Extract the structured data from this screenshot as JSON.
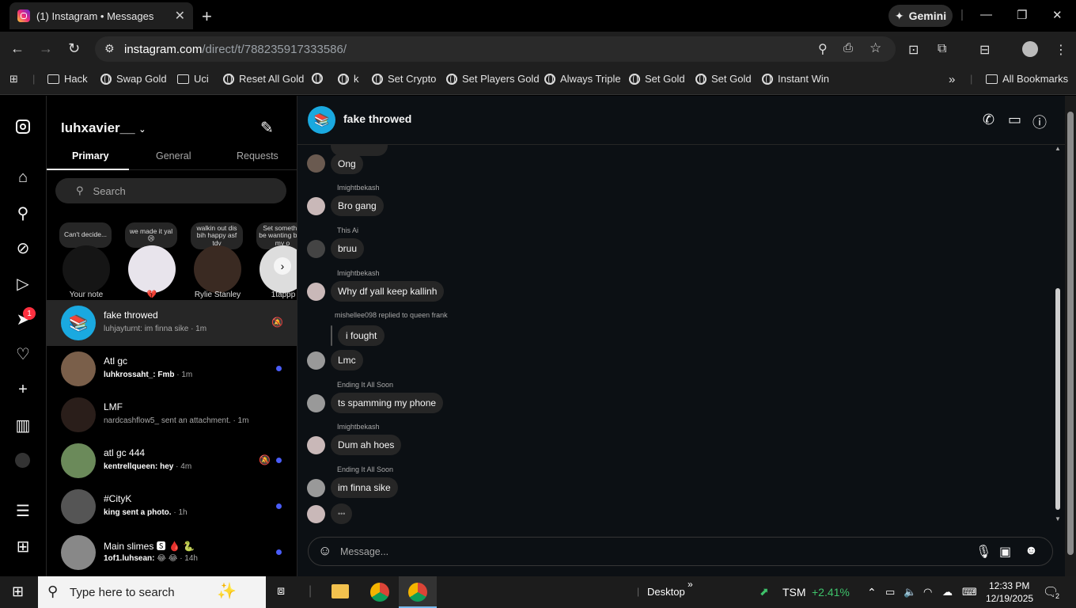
{
  "browser": {
    "tab_title": "(1) Instagram • Messages",
    "url_host": "instagram.com",
    "url_path": "/direct/t/788235917333586/",
    "gemini_label": "Gemini",
    "bookmarks": [
      "Hack",
      "Swap Gold",
      "Uci",
      "Reset All Gold",
      "",
      "k",
      "Set Crypto",
      "Set Players Gold",
      "Always Triple",
      "Set Gold",
      "Set Gold",
      "Instant Win"
    ],
    "all_bookmarks": "All Bookmarks"
  },
  "nav": {
    "messages_badge": "1"
  },
  "inbox": {
    "username": "luhxavier__",
    "tabs": [
      "Primary",
      "General",
      "Requests"
    ],
    "search_placeholder": "Search",
    "notes": [
      {
        "bubble": "Can't decide...",
        "name": "Your note"
      },
      {
        "bubble": "we made it yal 😢",
        "name": "💔"
      },
      {
        "bubble": "walkin out dis bih happy asf tdy",
        "name": "Rylie Stanley"
      },
      {
        "bubble": "Set somethin be wanting bust my o",
        "name": "1tappp"
      }
    ],
    "conversations": [
      {
        "name": "fake throwed",
        "preview_sender": "",
        "preview": "luhjayturnt: im finna sike",
        "time": "· 1m"
      },
      {
        "name": "Atl gc",
        "preview_sender": "luhkrossaht_:",
        "preview": "Fmb",
        "time": "· 1m"
      },
      {
        "name": "LMF",
        "preview_sender": "",
        "preview": "nardcashflow5_ sent an attachment.",
        "time": "· 1m"
      },
      {
        "name": "atl gc 444",
        "preview_sender": "kentrellqueen:",
        "preview": "hey",
        "time": "· 4m"
      },
      {
        "name": "#CityK",
        "preview_sender": "king sent a photo.",
        "preview": "",
        "time": "· 1h"
      },
      {
        "name": "Main slimes 🆂 🩸 🐍",
        "preview_sender": "1of1.luhsean:",
        "preview": "😂 😂",
        "time": "· 14h"
      }
    ]
  },
  "chat": {
    "title": "fake throwed",
    "messages": [
      {
        "sender": "",
        "text": "Ong"
      },
      {
        "sender": "Imightbekash",
        "text": "Bro gang"
      },
      {
        "sender": "This Ai",
        "text": "bruu"
      },
      {
        "sender": "Imightbekash",
        "text": "Why df yall keep kallinh"
      },
      {
        "sender": "mishellee098 replied to queen frank",
        "reply": "i fought",
        "text": "Lmc"
      },
      {
        "sender": "Ending It All Soon",
        "text": "ts spamming my phone"
      },
      {
        "sender": "Imightbekash",
        "text": "Dum ah hoes"
      },
      {
        "sender": "Ending It All Soon",
        "text": "im finna sike"
      },
      {
        "sender": "",
        "text": "•••"
      }
    ],
    "composer_placeholder": "Message..."
  },
  "taskbar": {
    "search_placeholder": "Type here to search",
    "desktop_label": "Desktop",
    "stock_symbol": "TSM",
    "stock_change": "+2.41%",
    "time": "12:33 PM",
    "date": "12/19/2025",
    "notif_count": "2"
  }
}
